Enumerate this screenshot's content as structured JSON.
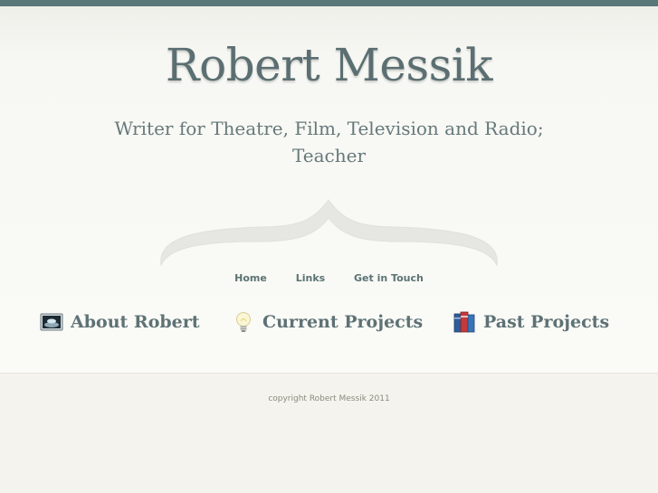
{
  "header": {
    "title": "Robert Messik",
    "tagline_line1": "Writer for Theatre, Film, Television and Radio;",
    "tagline_line2": "Teacher"
  },
  "nav": {
    "items": [
      {
        "label": "Home"
      },
      {
        "label": "Links"
      },
      {
        "label": "Get in Touch"
      }
    ]
  },
  "features": [
    {
      "label": "About Robert",
      "icon": "picture-frame-icon"
    },
    {
      "label": "Current Projects",
      "icon": "lightbulb-icon"
    },
    {
      "label": "Past Projects",
      "icon": "books-icon"
    }
  ],
  "footer": {
    "copyright": "copyright Robert Messik 2011"
  },
  "colors": {
    "top_bar": "#5b7878",
    "title": "#5b6f72",
    "nav_link": "#5b7373",
    "background": "#f4f3ee"
  }
}
